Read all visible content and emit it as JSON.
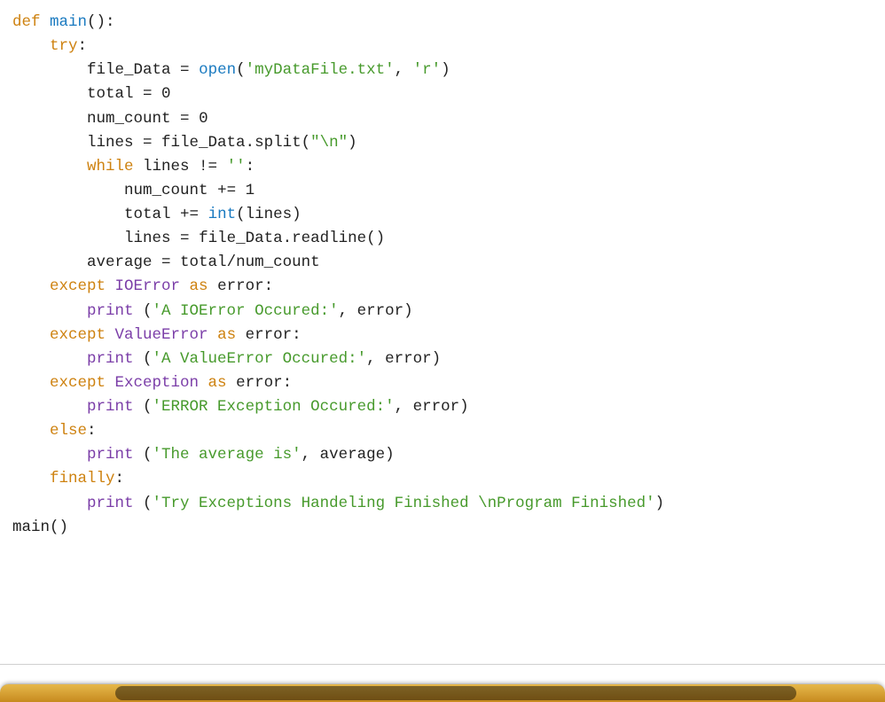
{
  "code": {
    "lines": [
      {
        "indent": 0,
        "tokens": [
          {
            "t": "def ",
            "c": "kw"
          },
          {
            "t": "main",
            "c": "fn"
          },
          {
            "t": "():",
            "c": "op"
          }
        ]
      },
      {
        "indent": 1,
        "tokens": [
          {
            "t": "try",
            "c": "kw"
          },
          {
            "t": ":",
            "c": "op"
          }
        ]
      },
      {
        "indent": 2,
        "tokens": [
          {
            "t": "file_Data ",
            "c": "id"
          },
          {
            "t": "= ",
            "c": "op"
          },
          {
            "t": "open",
            "c": "fn"
          },
          {
            "t": "(",
            "c": "op"
          },
          {
            "t": "'myDataFile.txt'",
            "c": "str"
          },
          {
            "t": ", ",
            "c": "op"
          },
          {
            "t": "'r'",
            "c": "str"
          },
          {
            "t": ")",
            "c": "op"
          }
        ]
      },
      {
        "indent": 2,
        "tokens": [
          {
            "t": "total ",
            "c": "id"
          },
          {
            "t": "= ",
            "c": "op"
          },
          {
            "t": "0",
            "c": "num"
          }
        ]
      },
      {
        "indent": 2,
        "tokens": [
          {
            "t": "num_count ",
            "c": "id"
          },
          {
            "t": "= ",
            "c": "op"
          },
          {
            "t": "0",
            "c": "num"
          }
        ]
      },
      {
        "indent": 2,
        "tokens": [
          {
            "t": "lines ",
            "c": "id"
          },
          {
            "t": "= ",
            "c": "op"
          },
          {
            "t": "file_Data.split(",
            "c": "id"
          },
          {
            "t": "\"",
            "c": "str"
          },
          {
            "t": "\\n",
            "c": "esc"
          },
          {
            "t": "\"",
            "c": "str"
          },
          {
            "t": ")",
            "c": "op"
          }
        ]
      },
      {
        "indent": 0,
        "tokens": [
          {
            "t": "",
            "c": "id"
          }
        ]
      },
      {
        "indent": 2,
        "tokens": [
          {
            "t": "while ",
            "c": "kw"
          },
          {
            "t": "lines ",
            "c": "id"
          },
          {
            "t": "!= ",
            "c": "op"
          },
          {
            "t": "''",
            "c": "str"
          },
          {
            "t": ":",
            "c": "op"
          }
        ]
      },
      {
        "indent": 3,
        "tokens": [
          {
            "t": "num_count ",
            "c": "id"
          },
          {
            "t": "+= ",
            "c": "op"
          },
          {
            "t": "1",
            "c": "num"
          }
        ]
      },
      {
        "indent": 3,
        "tokens": [
          {
            "t": "total ",
            "c": "id"
          },
          {
            "t": "+= ",
            "c": "op"
          },
          {
            "t": "int",
            "c": "fn"
          },
          {
            "t": "(lines)",
            "c": "op"
          }
        ]
      },
      {
        "indent": 3,
        "tokens": [
          {
            "t": "lines ",
            "c": "id"
          },
          {
            "t": "= ",
            "c": "op"
          },
          {
            "t": "file_Data.readline()",
            "c": "id"
          }
        ]
      },
      {
        "indent": 0,
        "tokens": [
          {
            "t": "",
            "c": "id"
          }
        ]
      },
      {
        "indent": 2,
        "tokens": [
          {
            "t": "average ",
            "c": "id"
          },
          {
            "t": "= ",
            "c": "op"
          },
          {
            "t": "total",
            "c": "id"
          },
          {
            "t": "/",
            "c": "op"
          },
          {
            "t": "num_count",
            "c": "id"
          }
        ]
      },
      {
        "indent": 1,
        "tokens": [
          {
            "t": "except ",
            "c": "kw"
          },
          {
            "t": "IOError",
            "c": "clsv"
          },
          {
            "t": " as ",
            "c": "kw"
          },
          {
            "t": "error",
            "c": "id"
          },
          {
            "t": ":",
            "c": "op"
          }
        ]
      },
      {
        "indent": 2,
        "tokens": [
          {
            "t": "print ",
            "c": "call"
          },
          {
            "t": "(",
            "c": "op"
          },
          {
            "t": "'A IOError Occured:'",
            "c": "str"
          },
          {
            "t": ", error)",
            "c": "op"
          }
        ]
      },
      {
        "indent": 1,
        "tokens": [
          {
            "t": "except ",
            "c": "kw"
          },
          {
            "t": "ValueError",
            "c": "clsv"
          },
          {
            "t": " as ",
            "c": "kw"
          },
          {
            "t": "error",
            "c": "id"
          },
          {
            "t": ":",
            "c": "op"
          }
        ]
      },
      {
        "indent": 2,
        "tokens": [
          {
            "t": "print ",
            "c": "call"
          },
          {
            "t": "(",
            "c": "op"
          },
          {
            "t": "'A ValueError Occured:'",
            "c": "str"
          },
          {
            "t": ", error)",
            "c": "op"
          }
        ]
      },
      {
        "indent": 1,
        "tokens": [
          {
            "t": "except ",
            "c": "kw"
          },
          {
            "t": "Exception",
            "c": "clsv"
          },
          {
            "t": " as ",
            "c": "kw"
          },
          {
            "t": "error",
            "c": "id"
          },
          {
            "t": ":",
            "c": "op"
          }
        ]
      },
      {
        "indent": 2,
        "tokens": [
          {
            "t": "print ",
            "c": "call"
          },
          {
            "t": "(",
            "c": "op"
          },
          {
            "t": "'ERROR Exception Occured:'",
            "c": "str"
          },
          {
            "t": ", error)",
            "c": "op"
          }
        ]
      },
      {
        "indent": 1,
        "tokens": [
          {
            "t": "else",
            "c": "kw"
          },
          {
            "t": ":",
            "c": "op"
          }
        ]
      },
      {
        "indent": 2,
        "tokens": [
          {
            "t": "print ",
            "c": "call"
          },
          {
            "t": "(",
            "c": "op"
          },
          {
            "t": "'The average is'",
            "c": "str"
          },
          {
            "t": ", average)",
            "c": "op"
          }
        ]
      },
      {
        "indent": 1,
        "tokens": [
          {
            "t": "finally",
            "c": "kw"
          },
          {
            "t": ":",
            "c": "op"
          }
        ]
      },
      {
        "indent": 2,
        "tokens": [
          {
            "t": "print ",
            "c": "call"
          },
          {
            "t": "(",
            "c": "op"
          },
          {
            "t": "'Try Exceptions Handeling Finished ",
            "c": "str"
          },
          {
            "t": "\\n",
            "c": "esc"
          },
          {
            "t": "Program Finished'",
            "c": "str"
          },
          {
            "t": ")",
            "c": "op"
          }
        ]
      },
      {
        "indent": 0,
        "tokens": [
          {
            "t": "main()",
            "c": "id"
          }
        ]
      }
    ],
    "indent_unit": "    "
  }
}
